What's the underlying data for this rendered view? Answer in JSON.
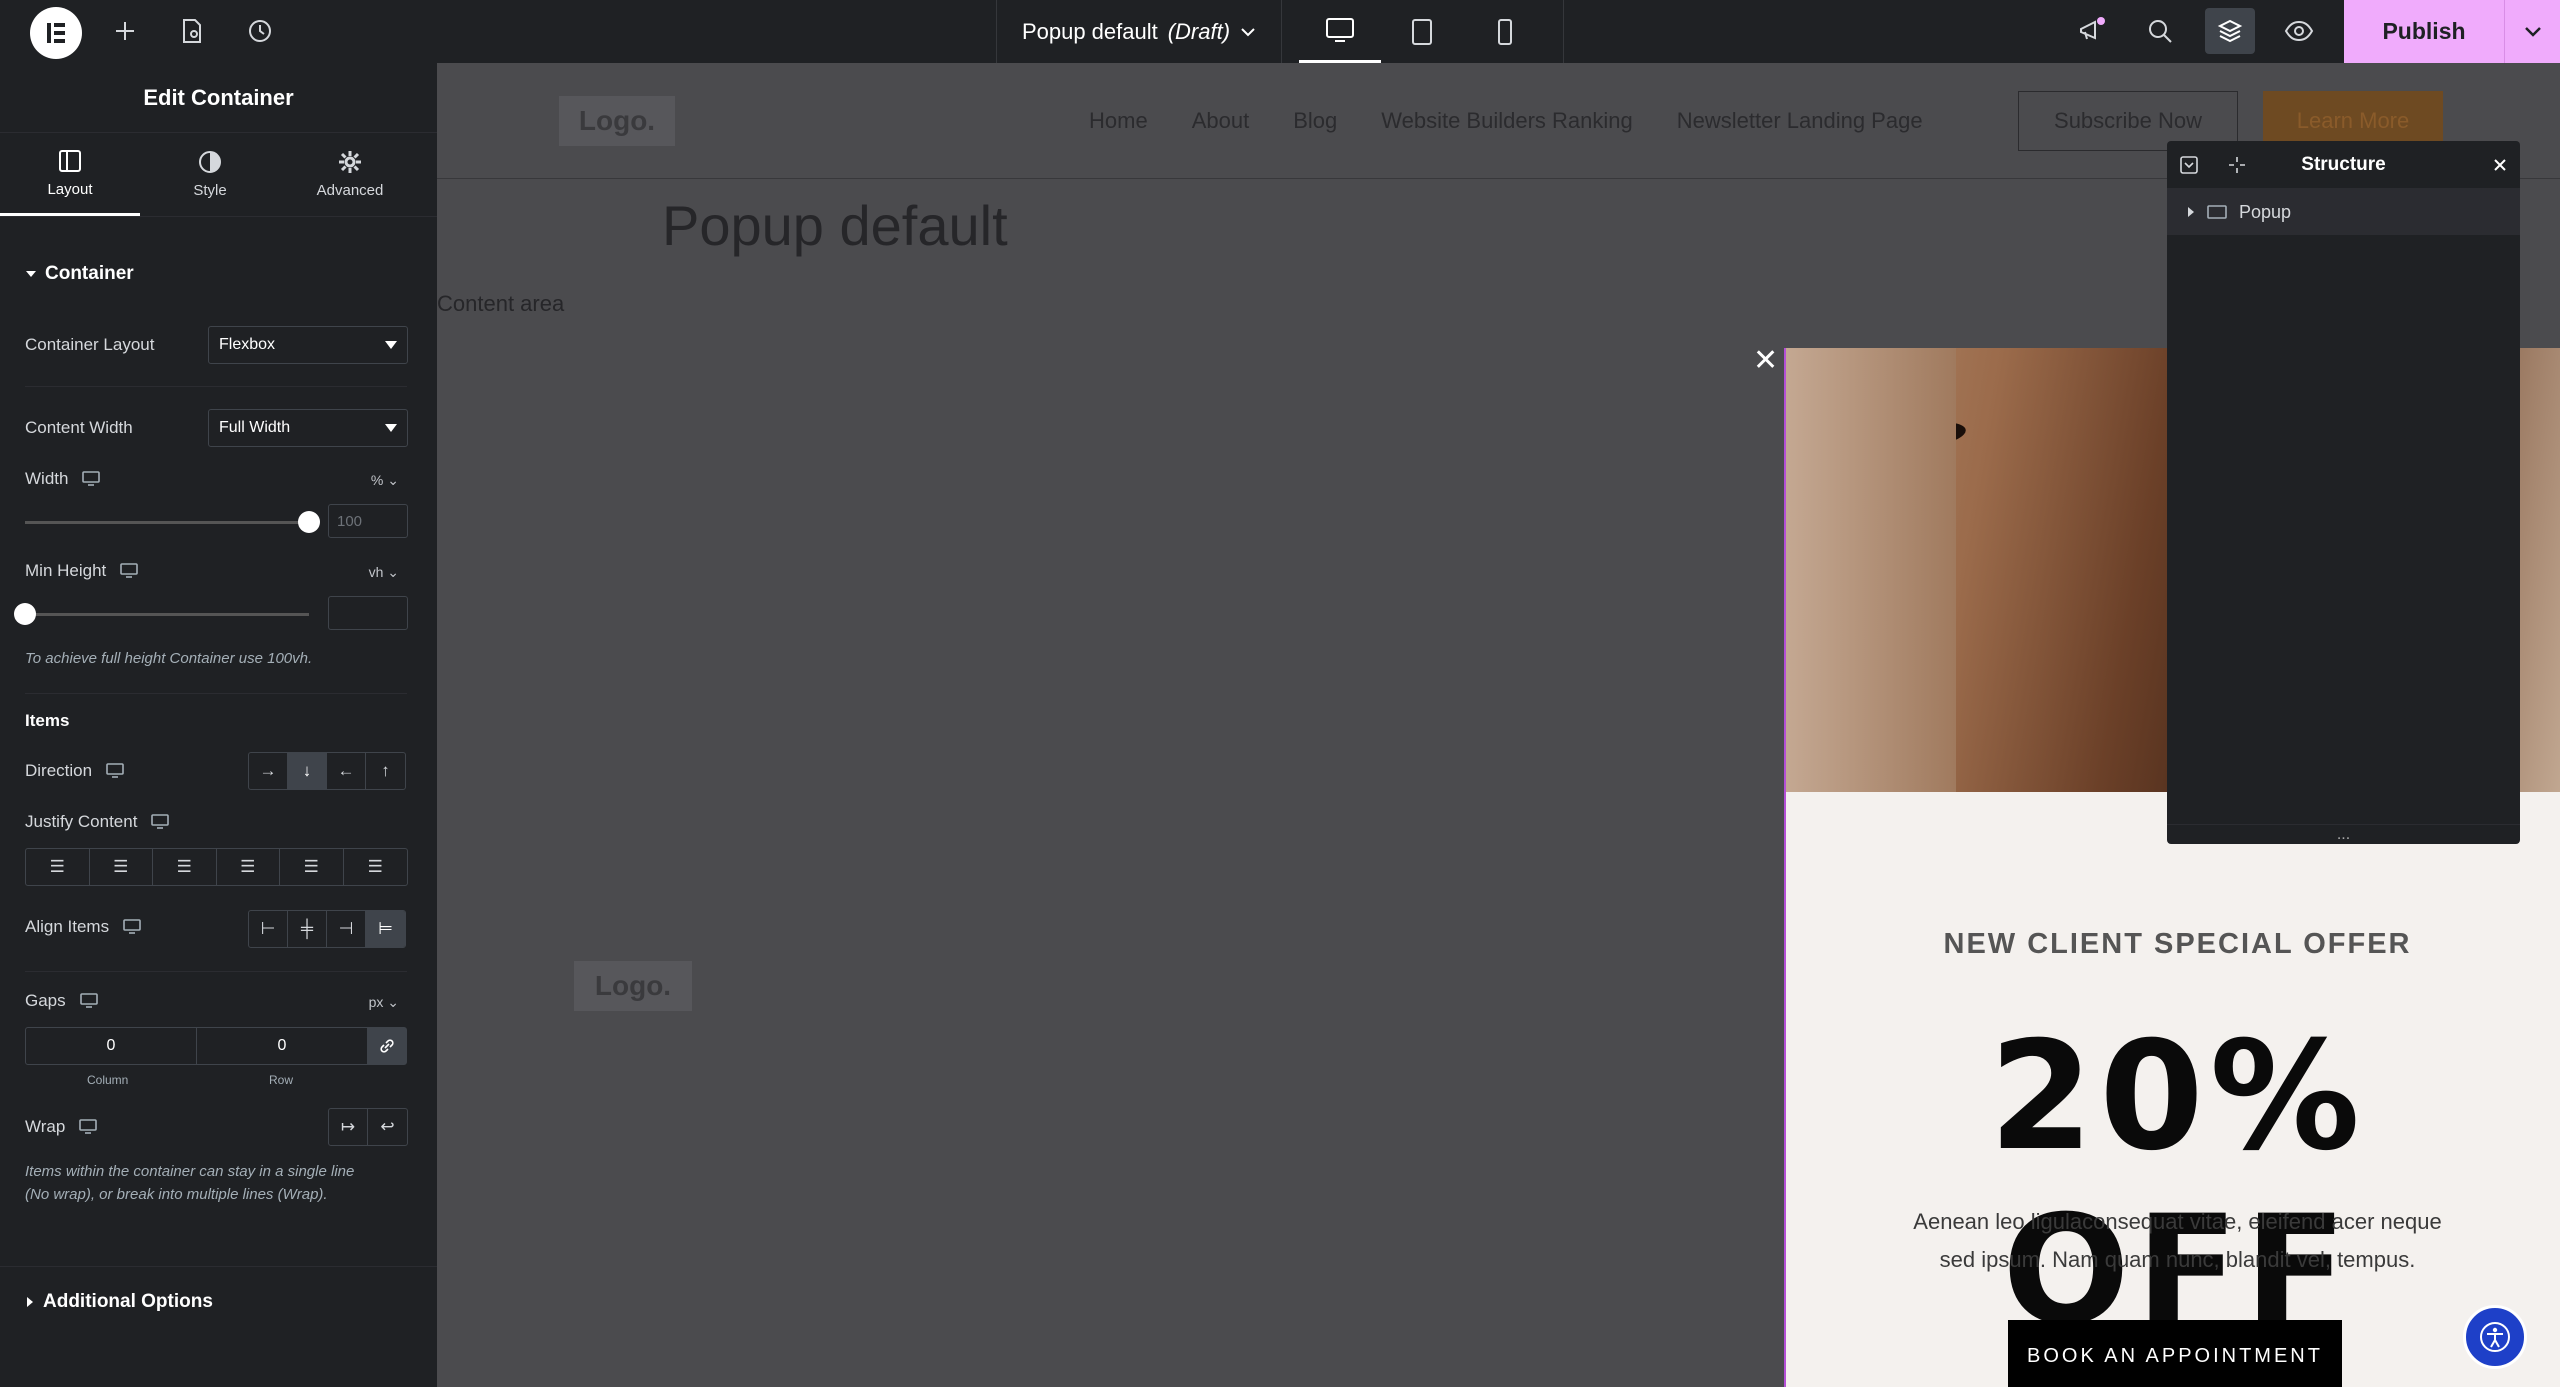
{
  "topbar": {
    "doc_title": "Popup default",
    "doc_status": "(Draft)",
    "publish_label": "Publish"
  },
  "panel": {
    "title": "Edit Container",
    "tabs": [
      {
        "label": "Layout",
        "icon": "layout-icon"
      },
      {
        "label": "Style",
        "icon": "style-icon"
      },
      {
        "label": "Advanced",
        "icon": "gear-icon"
      }
    ],
    "container_section": "Container",
    "container_layout_label": "Container Layout",
    "container_layout_value": "Flexbox",
    "content_width_label": "Content Width",
    "content_width_value": "Full Width",
    "width_label": "Width",
    "width_unit": "%",
    "width_value": "100",
    "width_slider_fraction": 1.0,
    "min_height_label": "Min Height",
    "min_height_unit": "vh",
    "min_height_slider_fraction": 0.0,
    "min_height_hint": "To achieve full height Container use 100vh.",
    "items_section": "Items",
    "direction_label": "Direction",
    "justify_label": "Justify Content",
    "align_label": "Align Items",
    "gaps_label": "Gaps",
    "gaps_unit": "px",
    "gap_column": "0",
    "gap_row": "0",
    "gap_column_label": "Column",
    "gap_row_label": "Row",
    "wrap_label": "Wrap",
    "wrap_hint_1": "Items within the container can stay in a single line",
    "wrap_hint_2": "(No wrap), or break into multiple lines (Wrap).",
    "additional_section": "Additional Options"
  },
  "site": {
    "logo": "Logo.",
    "nav": [
      "Home",
      "About",
      "Blog",
      "Website Builders Ranking",
      "Newsletter Landing Page"
    ],
    "subscribe": "Subscribe Now",
    "learn_more": "Learn More",
    "page_title": "Popup default",
    "content_area": "Content area",
    "logo_2": "Logo."
  },
  "popup": {
    "subtitle": "NEW CLIENT SPECIAL OFFER",
    "headline": "20% OFF",
    "text_1": "Aenean leo ligulaconsequat vitae, eleifend acer neque",
    "text_2": "sed ipsum. Nam quam nunc, blandit vel, tempus.",
    "button": "BOOK AN APPOINTMENT"
  },
  "structure": {
    "title": "Structure",
    "item": "Popup",
    "footer": "..."
  }
}
